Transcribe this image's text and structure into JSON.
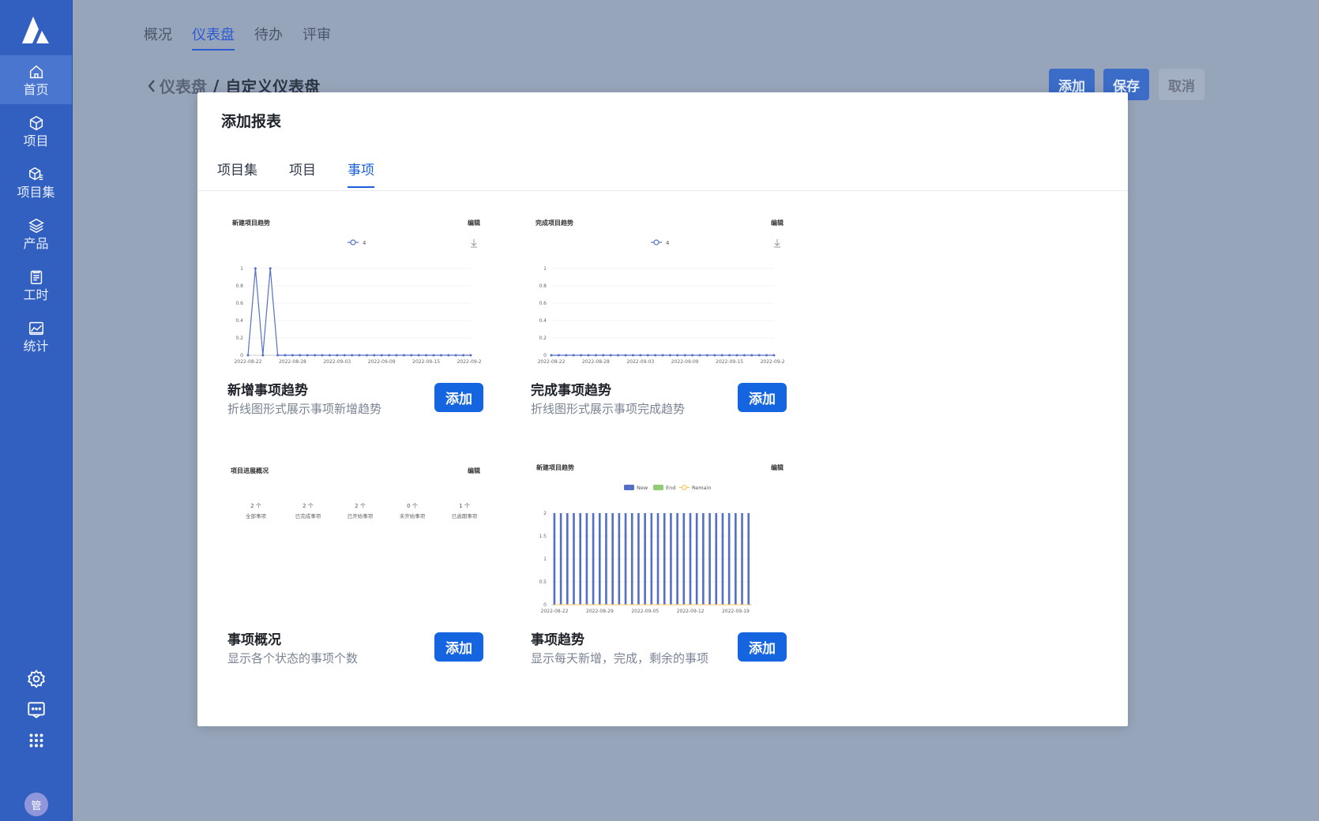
{
  "sidebar": {
    "items": [
      {
        "label": "首页",
        "icon": "home-icon",
        "active": true
      },
      {
        "label": "项目",
        "icon": "cube-icon",
        "active": false
      },
      {
        "label": "项目集",
        "icon": "cube-set-icon",
        "active": false
      },
      {
        "label": "产品",
        "icon": "layers-icon",
        "active": false
      },
      {
        "label": "工时",
        "icon": "clipboard-icon",
        "active": false
      },
      {
        "label": "统计",
        "icon": "chart-image-icon",
        "active": false
      }
    ],
    "bottom_icons": [
      "gear-icon",
      "message-icon",
      "apps-grid-icon"
    ],
    "avatar": "管"
  },
  "topnav": {
    "tabs": [
      "概况",
      "仪表盘",
      "待办",
      "评审"
    ],
    "active": "仪表盘"
  },
  "breadcrumb": {
    "back": "仪表盘",
    "separator": "/",
    "current": "自定义仪表盘"
  },
  "top_buttons": {
    "add": "添加",
    "save": "保存",
    "cancel": "取消"
  },
  "modal": {
    "title": "添加报表",
    "tabs": [
      "项目集",
      "项目",
      "事项"
    ],
    "active_tab": "事项",
    "add_label": "添加",
    "edit_label": "编辑",
    "cards": [
      {
        "title": "新增事项趋势",
        "desc": "折线图形式展示事项新增趋势",
        "thumb_title": "新建项目趋势",
        "legend": "4"
      },
      {
        "title": "完成事项趋势",
        "desc": "折线图形式展示事项完成趋势",
        "thumb_title": "完成项目趋势",
        "legend": "4"
      },
      {
        "title": "事项概况",
        "desc": "显示各个状态的事项个数",
        "thumb_title": "项目进展概况",
        "stats": [
          {
            "value": "2 个",
            "label": "全部事项"
          },
          {
            "value": "2 个",
            "label": "已完成事项"
          },
          {
            "value": "2 个",
            "label": "已开始事项"
          },
          {
            "value": "0 个",
            "label": "未开始事项"
          },
          {
            "value": "1 个",
            "label": "已逾期事项"
          }
        ]
      },
      {
        "title": "事项趋势",
        "desc": "显示每天新增，完成，剩余的事项",
        "thumb_title": "新建项目趋势",
        "legend": [
          "New",
          "End",
          "Remain"
        ]
      }
    ]
  },
  "colors": {
    "primary": "#1565e0",
    "sidebar": "#3260c0",
    "series": "#5470c6",
    "end": "#91cc75",
    "remain": "#fac858"
  },
  "chart_data": [
    {
      "type": "line",
      "title": "新建项目趋势",
      "x": [
        "2022-08-22",
        "2022-08-23",
        "2022-08-24",
        "2022-08-25",
        "2022-08-26",
        "2022-08-27",
        "2022-08-28",
        "2022-08-29",
        "2022-08-30",
        "2022-08-31",
        "2022-09-01",
        "2022-09-02",
        "2022-09-03",
        "2022-09-04",
        "2022-09-05",
        "2022-09-06",
        "2022-09-07",
        "2022-09-08",
        "2022-09-09",
        "2022-09-10",
        "2022-09-11",
        "2022-09-12",
        "2022-09-13",
        "2022-09-14",
        "2022-09-15",
        "2022-09-16",
        "2022-09-17",
        "2022-09-18",
        "2022-09-19",
        "2022-09-20",
        "2022-09-21"
      ],
      "x_ticks": [
        "2022-08-22",
        "2022-08-28",
        "2022-09-03",
        "2022-09-09",
        "2022-09-15",
        "2022-09-21"
      ],
      "y_ticks": [
        "0",
        "0.2",
        "0.4",
        "0.6",
        "0.8",
        "1"
      ],
      "ylim": [
        0,
        1
      ],
      "series": [
        {
          "name": "4",
          "values": [
            0,
            1,
            0,
            1,
            0,
            0,
            0,
            0,
            0,
            0,
            0,
            0,
            0,
            0,
            0,
            0,
            0,
            0,
            0,
            0,
            0,
            0,
            0,
            0,
            0,
            0,
            0,
            0,
            0,
            0,
            0
          ]
        }
      ]
    },
    {
      "type": "line",
      "title": "完成项目趋势",
      "x": [
        "2022-08-22",
        "2022-08-23",
        "2022-08-24",
        "2022-08-25",
        "2022-08-26",
        "2022-08-27",
        "2022-08-28",
        "2022-08-29",
        "2022-08-30",
        "2022-08-31",
        "2022-09-01",
        "2022-09-02",
        "2022-09-03",
        "2022-09-04",
        "2022-09-05",
        "2022-09-06",
        "2022-09-07",
        "2022-09-08",
        "2022-09-09",
        "2022-09-10",
        "2022-09-11",
        "2022-09-12",
        "2022-09-13",
        "2022-09-14",
        "2022-09-15",
        "2022-09-16",
        "2022-09-17",
        "2022-09-18",
        "2022-09-19",
        "2022-09-20",
        "2022-09-21"
      ],
      "x_ticks": [
        "2022-08-22",
        "2022-08-28",
        "2022-09-03",
        "2022-09-09",
        "2022-09-15",
        "2022-09-21"
      ],
      "y_ticks": [
        "0",
        "0.2",
        "0.4",
        "0.6",
        "0.8",
        "1"
      ],
      "ylim": [
        0,
        1
      ],
      "series": [
        {
          "name": "4",
          "values": [
            0,
            0,
            0,
            0,
            0,
            0,
            0,
            0,
            0,
            0,
            0,
            0,
            0,
            0,
            0,
            0,
            0,
            0,
            0,
            0,
            0,
            0,
            0,
            0,
            0,
            0,
            0,
            0,
            0,
            0,
            0
          ]
        }
      ]
    },
    {
      "type": "bar",
      "title": "新建项目趋势",
      "x_ticks": [
        "2022-08-22",
        "2022-08-29",
        "2022-09-05",
        "2022-09-12",
        "2022-09-19"
      ],
      "y_ticks": [
        "0",
        "0.5",
        "1",
        "1.5",
        "2"
      ],
      "ylim": [
        0,
        2
      ],
      "categories_count": 31,
      "series": [
        {
          "name": "New",
          "values": [
            2,
            2,
            2,
            2,
            2,
            2,
            2,
            2,
            2,
            2,
            2,
            2,
            2,
            2,
            2,
            2,
            2,
            2,
            2,
            2,
            2,
            2,
            2,
            2,
            2,
            2,
            2,
            2,
            2,
            2,
            2
          ]
        },
        {
          "name": "End",
          "values": [
            0,
            0,
            0,
            0,
            0,
            0,
            0,
            0,
            0,
            0,
            0,
            0,
            0,
            0,
            0,
            0,
            0,
            0,
            0,
            0,
            0,
            0,
            0,
            0,
            0,
            0,
            0,
            0,
            0,
            0,
            0
          ]
        },
        {
          "name": "Remain",
          "values": [
            0,
            0,
            0,
            0,
            0,
            0,
            0,
            0,
            0,
            0,
            0,
            0,
            0,
            0,
            0,
            0,
            0,
            0,
            0,
            0,
            0,
            0,
            0,
            0,
            0,
            0,
            0,
            0,
            0,
            0,
            0
          ]
        }
      ]
    }
  ]
}
